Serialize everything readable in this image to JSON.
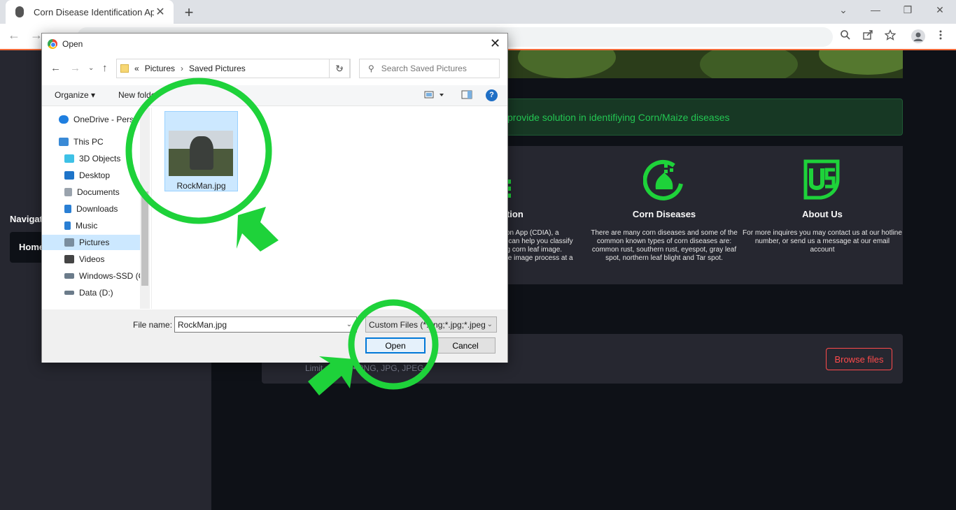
{
  "browser": {
    "tab_title": "Corn Disease Identification App",
    "tab_close": "✕",
    "new_tab": "+",
    "window_controls": [
      "⌄",
      "—",
      "❐",
      "✕"
    ],
    "back": "←",
    "forward": "→"
  },
  "sidebar": {
    "nav_label": "Navigati",
    "home_label": "Home"
  },
  "banner": {
    "text": "provide solution in identifiying Corn/Maize diseases"
  },
  "cards": [
    {
      "title": "ption",
      "text": "tion App (CDIA), a\nh can help you classify\nng corn leaf image.\ngle image process at a"
    },
    {
      "title": "Corn Diseases",
      "text": "There are many corn diseases and some of the common known types of corn diseases are: common rust, southern rust, eyespot, gray leaf spot, northern leaf blight and Tar spot."
    },
    {
      "title": "About Us",
      "text": "For more inquires you may contact us at our hotline number, or send us a message at our email account"
    }
  ],
  "uploader": {
    "limit_text": "Limit        per file • PNG, JPG, JPEG",
    "browse_label": "Browse files"
  },
  "dialog": {
    "title": "Open",
    "close": "✕",
    "path_prefix": "«",
    "path": [
      "Pictures",
      "Saved Pictures"
    ],
    "search_placeholder": "Search Saved Pictures",
    "organize_label": "Organize ▾",
    "new_folder_label": "New folde",
    "help": "?",
    "nav_items": [
      {
        "label": "OneDrive - Perso",
        "icon": "cloud-icon",
        "color": "#1f7fe0"
      },
      {
        "label": "This PC",
        "icon": "computer-icon",
        "color": "#3a8ad6"
      },
      {
        "label": "3D Objects",
        "icon": "cube-icon",
        "color": "#3ec1e6"
      },
      {
        "label": "Desktop",
        "icon": "desktop-icon",
        "color": "#1e74c9"
      },
      {
        "label": "Documents",
        "icon": "document-icon",
        "color": "#9aa3ad"
      },
      {
        "label": "Downloads",
        "icon": "download-icon",
        "color": "#2a7fd4"
      },
      {
        "label": "Music",
        "icon": "music-icon",
        "color": "#2a7fd4"
      },
      {
        "label": "Pictures",
        "icon": "pictures-icon",
        "color": "#7a8d9e"
      },
      {
        "label": "Videos",
        "icon": "video-icon",
        "color": "#444444"
      },
      {
        "label": "Windows-SSD (C",
        "icon": "drive-icon",
        "color": "#6b7b8a"
      },
      {
        "label": "Data (D:)",
        "icon": "drive-icon",
        "color": "#6b7b8a"
      }
    ],
    "file": {
      "name": "RockMan.jpg"
    },
    "filename_label": "File name:",
    "filename_value": "RockMan.jpg",
    "filter_value": "Custom Files (*.png;*.jpg;*.jpeg",
    "open_label": "Open",
    "cancel_label": "Cancel"
  },
  "colors": {
    "annotation_green": "#1ed23a",
    "app_bg": "#0e1117",
    "sidebar_bg": "#262730",
    "accent_red": "#ff4b4b",
    "success_green": "#23c552"
  }
}
